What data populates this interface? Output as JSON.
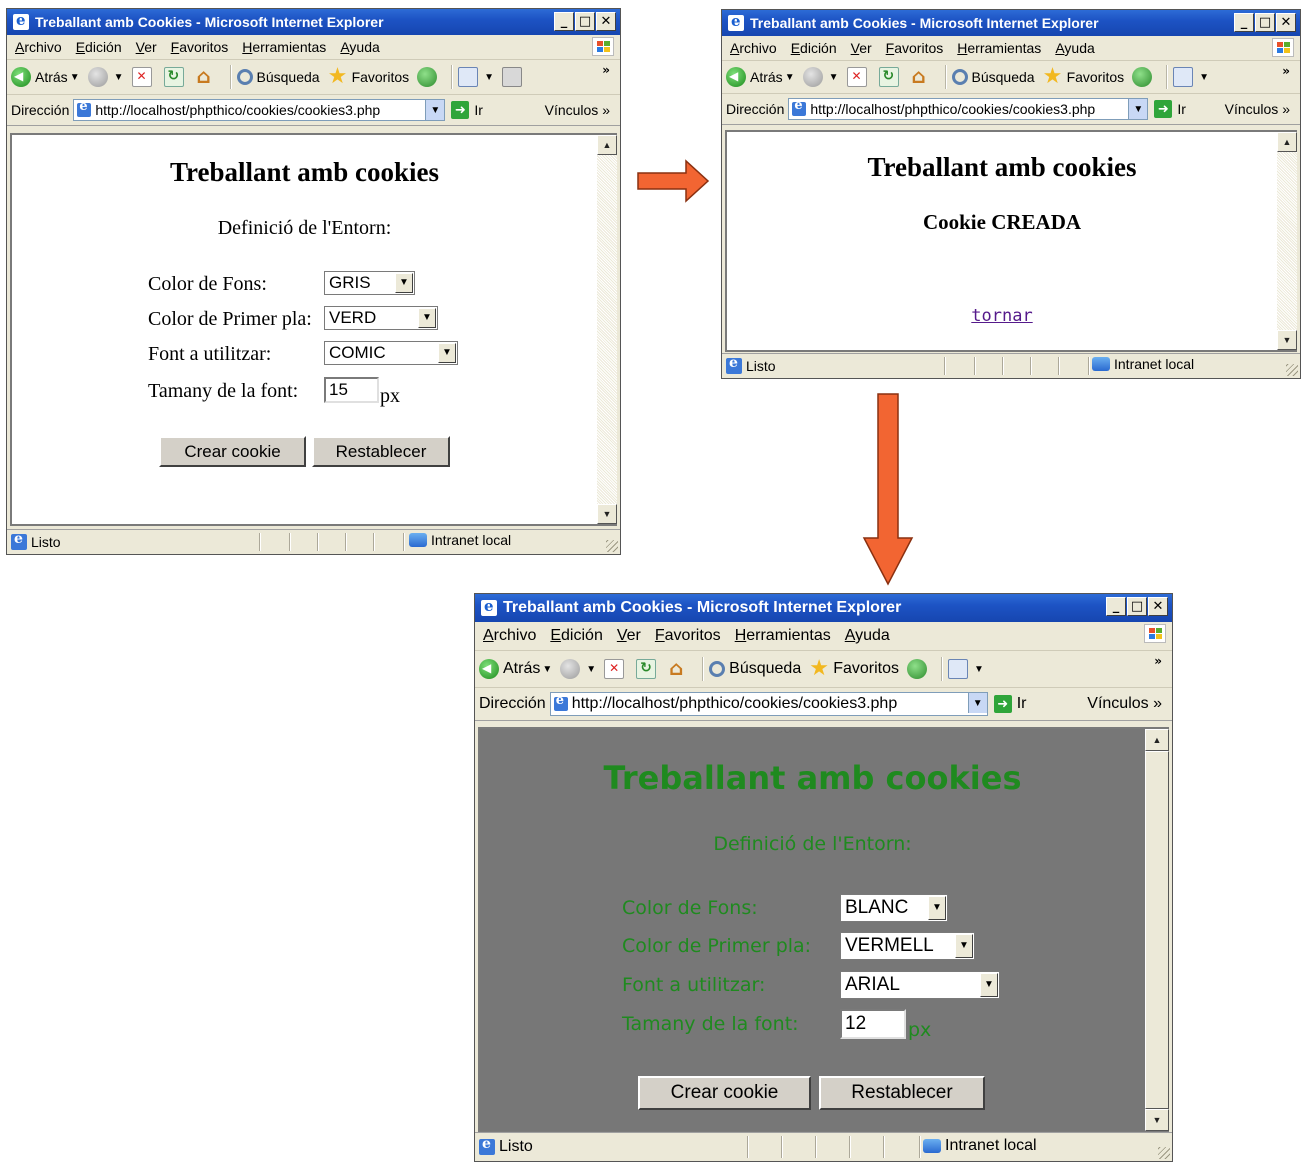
{
  "browser": {
    "title": "Treballant amb Cookies - Microsoft Internet Explorer",
    "menu": [
      "Archivo",
      "Edición",
      "Ver",
      "Favoritos",
      "Herramientas",
      "Ayuda"
    ],
    "toolbar": {
      "back": "Atrás",
      "search": "Búsqueda",
      "favorites": "Favoritos"
    },
    "address_label": "Dirección",
    "url": "http://localhost/phpthico/cookies/cookies3.php",
    "go": "Ir",
    "links": "Vínculos",
    "status": "Listo",
    "zone": "Intranet local",
    "window_buttons": {
      "minimize": "_",
      "maximize": "□",
      "close": "✕"
    }
  },
  "form_page": {
    "title": "Treballant amb cookies",
    "subtitle": "Definició de l'Entorn:",
    "labels": {
      "bg": "Color de Fons:",
      "fg": "Color de Primer pla:",
      "font": "Font a utilitzar:",
      "size": "Tamany de la font:"
    },
    "unit": "px",
    "buttons": {
      "create": "Crear cookie",
      "reset": "Restablecer"
    }
  },
  "window1": {
    "bg": "GRIS",
    "fg": "VERD",
    "font": "COMIC",
    "size": "15"
  },
  "window2": {
    "message": "Cookie CREADA",
    "link": "tornar"
  },
  "window3": {
    "bg": "BLANC",
    "fg": "VERMELL",
    "font": "ARIAL",
    "size": "12",
    "page_bg": "#777777",
    "page_fg": "#1f8a1f"
  },
  "arrow_color": "#f26532"
}
